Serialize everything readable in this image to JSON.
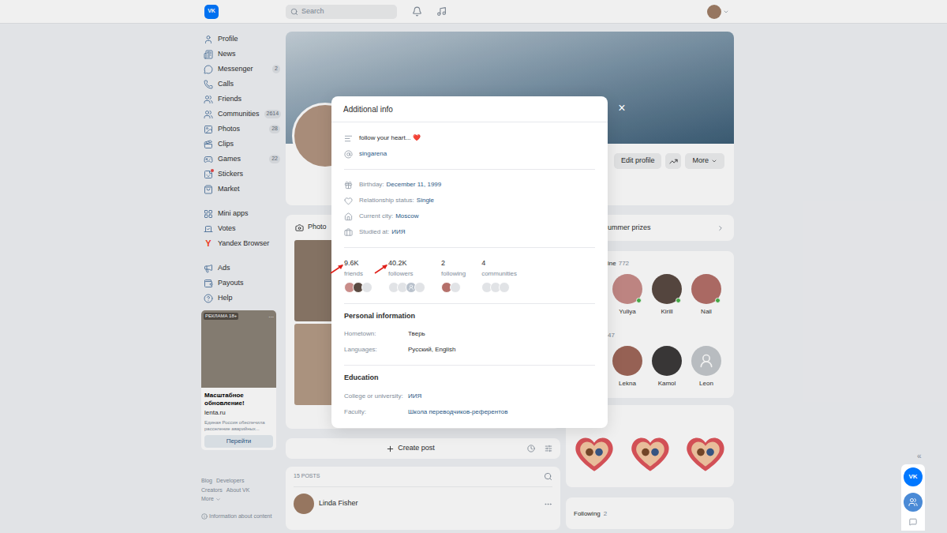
{
  "topbar": {
    "logo": "VK",
    "search_placeholder": "Search"
  },
  "sidebar": {
    "groups": [
      [
        {
          "label": "Profile",
          "badge": "",
          "glyph": "",
          "dot": false
        },
        {
          "label": "News",
          "badge": "",
          "glyph": "",
          "dot": false
        },
        {
          "label": "Messenger",
          "badge": "2",
          "glyph": "",
          "dot": false
        },
        {
          "label": "Calls",
          "badge": "",
          "glyph": "",
          "dot": false
        },
        {
          "label": "Friends",
          "badge": "",
          "glyph": "",
          "dot": false
        },
        {
          "label": "Communities",
          "badge": "2614",
          "glyph": "",
          "dot": false
        },
        {
          "label": "Photos",
          "badge": "28",
          "glyph": "",
          "dot": false
        },
        {
          "label": "Clips",
          "badge": "",
          "glyph": "",
          "dot": false
        },
        {
          "label": "Games",
          "badge": "22",
          "glyph": "",
          "dot": false
        },
        {
          "label": "Stickers",
          "badge": "",
          "glyph": "",
          "dot": true
        },
        {
          "label": "Market",
          "badge": "",
          "glyph": "",
          "dot": false
        }
      ],
      [
        {
          "label": "Mini apps",
          "badge": "",
          "glyph": "",
          "dot": false
        },
        {
          "label": "Votes",
          "badge": "",
          "glyph": "",
          "dot": false
        },
        {
          "label": "Yandex Browser",
          "badge": "",
          "glyph": "Y",
          "dot": false
        }
      ],
      [
        {
          "label": "Ads",
          "badge": "",
          "glyph": "",
          "dot": false
        },
        {
          "label": "Payouts",
          "badge": "",
          "glyph": "",
          "dot": false
        },
        {
          "label": "Help",
          "badge": "",
          "glyph": "",
          "dot": false
        }
      ]
    ]
  },
  "ad": {
    "label": "РЕКЛАМА 18+",
    "menu": "...",
    "title": "Масштабное обновление!",
    "source": "lenta.ru",
    "text": "Единая Россия обеспечила расселение аварийных...",
    "button": "Перейти"
  },
  "footer": {
    "rows": [
      [
        "Blog",
        "Developers"
      ],
      [
        "Creators",
        "About VK"
      ]
    ],
    "more": "More",
    "info": "Information about content"
  },
  "profile": {
    "buttons": [
      "Edit profile",
      "More"
    ]
  },
  "photos": {
    "title": "Photo"
  },
  "create_post": {
    "label": "Create post"
  },
  "posts": {
    "count": "15 POSTS",
    "first_author": "Linda Fisher"
  },
  "prizes": {
    "title": "ummer prizes"
  },
  "friends_online": {
    "title": "ine",
    "count": "772",
    "people": [
      {
        "name": "Yuliya",
        "online": true,
        "has_photo": true
      },
      {
        "name": "Kirill",
        "online": true,
        "has_photo": true
      },
      {
        "name": "Nail",
        "online": true,
        "has_photo": true
      }
    ]
  },
  "friends": {
    "title": "47",
    "people": [
      {
        "name": "Lekna",
        "online": false,
        "has_photo": true
      },
      {
        "name": "Kamol",
        "online": false,
        "has_photo": true
      },
      {
        "name": "Leon",
        "online": false,
        "has_photo": false
      }
    ]
  },
  "gifts": [
    {
      "kind": "heart"
    },
    {
      "kind": "heart"
    },
    {
      "kind": "heart"
    }
  ],
  "following": {
    "title": "Following",
    "count": "2"
  },
  "modal": {
    "title": "Additional info",
    "close": "×",
    "status": "follow your heart... ❤️",
    "username": "singarena",
    "details": [
      {
        "label": "Birthday:",
        "value": "December 11, 1999"
      },
      {
        "label": "Relationship status:",
        "value": "Single"
      },
      {
        "label": "Current city:",
        "value": "Moscow"
      },
      {
        "label": "Studied at:",
        "value": "ИИЯ"
      }
    ],
    "counters": [
      {
        "value": "9.6K",
        "label": "friends",
        "marked": true,
        "avatars": [
          "photo",
          "photo",
          "blank"
        ]
      },
      {
        "value": "40.2K",
        "label": "followers",
        "marked": true,
        "avatars": [
          "blank",
          "blank",
          "user",
          "blank"
        ]
      },
      {
        "value": "2",
        "label": "following",
        "marked": false,
        "avatars": [
          "photo",
          "blank"
        ]
      },
      {
        "value": "4",
        "label": "communities",
        "marked": false,
        "avatars": [
          "blank",
          "blank",
          "blank"
        ]
      }
    ],
    "sections": [
      {
        "title": "Personal information",
        "rows": [
          {
            "label": "Hometown:",
            "value": "Тверь",
            "link": false
          },
          {
            "label": "Languages:",
            "value": "Русский, English",
            "link": false
          }
        ]
      },
      {
        "title": "Education",
        "rows": [
          {
            "label": "College or university:",
            "value": "ИИЯ",
            "link": true
          },
          {
            "label": "Faculty:",
            "value": "Школа переводчиков-референтов",
            "link": true
          }
        ]
      }
    ]
  },
  "widget": {
    "logo": "VK",
    "collapse": "«"
  }
}
